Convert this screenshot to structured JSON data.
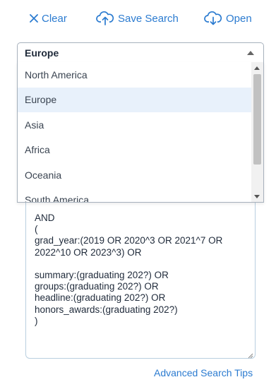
{
  "toolbar": {
    "clear_label": "Clear",
    "save_label": "Save Search",
    "open_label": "Open"
  },
  "region_select": {
    "selected": "Europe",
    "options": [
      "North America",
      "Europe",
      "Asia",
      "Africa",
      "Oceania",
      "South America"
    ]
  },
  "query": {
    "text": "AND\n(\ngrad_year:(2019 OR 2020^3 OR 2021^7 OR\n2022^10 OR 2023^3) OR\n\nsummary:(graduating 202?) OR\ngroups:(graduating 202?) OR\nheadline:(graduating 202?) OR\nhonors_awards:(graduating 202?)\n)"
  },
  "footer": {
    "tips_label": "Advanced Search Tips"
  },
  "colors": {
    "accent": "#2b7bd0",
    "selected_option_bg": "#e8f1fb",
    "text": "#1f2a3a"
  }
}
